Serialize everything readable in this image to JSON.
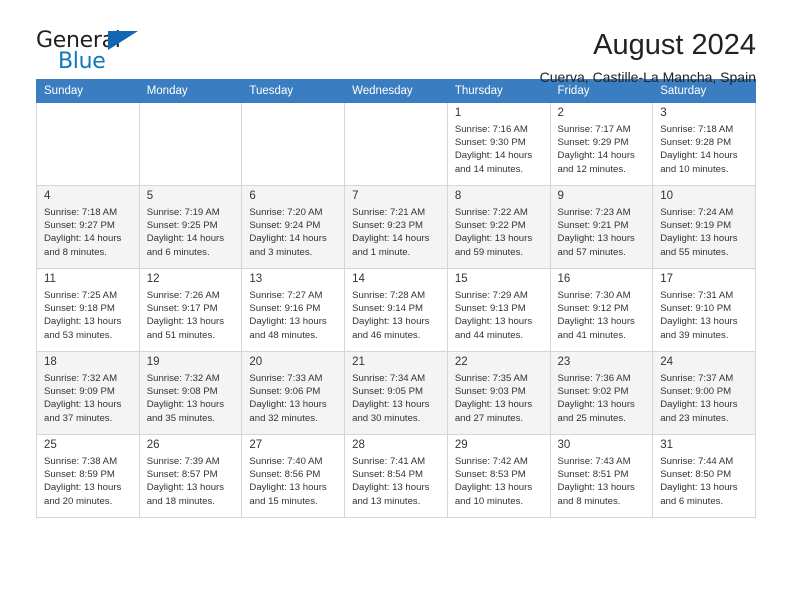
{
  "brand": {
    "name_top": "General",
    "name_bottom": "Blue",
    "triangle_color": "#1167b1",
    "blue_text_color": "#1278be"
  },
  "header": {
    "title": "August 2024",
    "subtitle": "Cuerva, Castille-La Mancha, Spain"
  },
  "theme": {
    "header_bg": "#3a7dc0",
    "header_text": "#ffffff",
    "shaded_row_bg": "#f4f4f4",
    "grid_line": "#d6d6d6"
  },
  "weekday_headers": [
    "Sunday",
    "Monday",
    "Tuesday",
    "Wednesday",
    "Thursday",
    "Friday",
    "Saturday"
  ],
  "labels": {
    "sunrise_prefix": "Sunrise:",
    "sunset_prefix": "Sunset:",
    "daylight_prefix": "Daylight:"
  },
  "weeks": [
    {
      "shaded": false,
      "days": [
        {
          "num": "",
          "l1": "",
          "l2": "",
          "l3": "",
          "l4": ""
        },
        {
          "num": "",
          "l1": "",
          "l2": "",
          "l3": "",
          "l4": ""
        },
        {
          "num": "",
          "l1": "",
          "l2": "",
          "l3": "",
          "l4": ""
        },
        {
          "num": "",
          "l1": "",
          "l2": "",
          "l3": "",
          "l4": ""
        },
        {
          "num": "1",
          "l1": "Sunrise: 7:16 AM",
          "l2": "Sunset: 9:30 PM",
          "l3": "Daylight: 14 hours",
          "l4": "and 14 minutes."
        },
        {
          "num": "2",
          "l1": "Sunrise: 7:17 AM",
          "l2": "Sunset: 9:29 PM",
          "l3": "Daylight: 14 hours",
          "l4": "and 12 minutes."
        },
        {
          "num": "3",
          "l1": "Sunrise: 7:18 AM",
          "l2": "Sunset: 9:28 PM",
          "l3": "Daylight: 14 hours",
          "l4": "and 10 minutes."
        }
      ]
    },
    {
      "shaded": true,
      "days": [
        {
          "num": "4",
          "l1": "Sunrise: 7:18 AM",
          "l2": "Sunset: 9:27 PM",
          "l3": "Daylight: 14 hours",
          "l4": "and 8 minutes."
        },
        {
          "num": "5",
          "l1": "Sunrise: 7:19 AM",
          "l2": "Sunset: 9:25 PM",
          "l3": "Daylight: 14 hours",
          "l4": "and 6 minutes."
        },
        {
          "num": "6",
          "l1": "Sunrise: 7:20 AM",
          "l2": "Sunset: 9:24 PM",
          "l3": "Daylight: 14 hours",
          "l4": "and 3 minutes."
        },
        {
          "num": "7",
          "l1": "Sunrise: 7:21 AM",
          "l2": "Sunset: 9:23 PM",
          "l3": "Daylight: 14 hours",
          "l4": "and 1 minute."
        },
        {
          "num": "8",
          "l1": "Sunrise: 7:22 AM",
          "l2": "Sunset: 9:22 PM",
          "l3": "Daylight: 13 hours",
          "l4": "and 59 minutes."
        },
        {
          "num": "9",
          "l1": "Sunrise: 7:23 AM",
          "l2": "Sunset: 9:21 PM",
          "l3": "Daylight: 13 hours",
          "l4": "and 57 minutes."
        },
        {
          "num": "10",
          "l1": "Sunrise: 7:24 AM",
          "l2": "Sunset: 9:19 PM",
          "l3": "Daylight: 13 hours",
          "l4": "and 55 minutes."
        }
      ]
    },
    {
      "shaded": false,
      "days": [
        {
          "num": "11",
          "l1": "Sunrise: 7:25 AM",
          "l2": "Sunset: 9:18 PM",
          "l3": "Daylight: 13 hours",
          "l4": "and 53 minutes."
        },
        {
          "num": "12",
          "l1": "Sunrise: 7:26 AM",
          "l2": "Sunset: 9:17 PM",
          "l3": "Daylight: 13 hours",
          "l4": "and 51 minutes."
        },
        {
          "num": "13",
          "l1": "Sunrise: 7:27 AM",
          "l2": "Sunset: 9:16 PM",
          "l3": "Daylight: 13 hours",
          "l4": "and 48 minutes."
        },
        {
          "num": "14",
          "l1": "Sunrise: 7:28 AM",
          "l2": "Sunset: 9:14 PM",
          "l3": "Daylight: 13 hours",
          "l4": "and 46 minutes."
        },
        {
          "num": "15",
          "l1": "Sunrise: 7:29 AM",
          "l2": "Sunset: 9:13 PM",
          "l3": "Daylight: 13 hours",
          "l4": "and 44 minutes."
        },
        {
          "num": "16",
          "l1": "Sunrise: 7:30 AM",
          "l2": "Sunset: 9:12 PM",
          "l3": "Daylight: 13 hours",
          "l4": "and 41 minutes."
        },
        {
          "num": "17",
          "l1": "Sunrise: 7:31 AM",
          "l2": "Sunset: 9:10 PM",
          "l3": "Daylight: 13 hours",
          "l4": "and 39 minutes."
        }
      ]
    },
    {
      "shaded": true,
      "days": [
        {
          "num": "18",
          "l1": "Sunrise: 7:32 AM",
          "l2": "Sunset: 9:09 PM",
          "l3": "Daylight: 13 hours",
          "l4": "and 37 minutes."
        },
        {
          "num": "19",
          "l1": "Sunrise: 7:32 AM",
          "l2": "Sunset: 9:08 PM",
          "l3": "Daylight: 13 hours",
          "l4": "and 35 minutes."
        },
        {
          "num": "20",
          "l1": "Sunrise: 7:33 AM",
          "l2": "Sunset: 9:06 PM",
          "l3": "Daylight: 13 hours",
          "l4": "and 32 minutes."
        },
        {
          "num": "21",
          "l1": "Sunrise: 7:34 AM",
          "l2": "Sunset: 9:05 PM",
          "l3": "Daylight: 13 hours",
          "l4": "and 30 minutes."
        },
        {
          "num": "22",
          "l1": "Sunrise: 7:35 AM",
          "l2": "Sunset: 9:03 PM",
          "l3": "Daylight: 13 hours",
          "l4": "and 27 minutes."
        },
        {
          "num": "23",
          "l1": "Sunrise: 7:36 AM",
          "l2": "Sunset: 9:02 PM",
          "l3": "Daylight: 13 hours",
          "l4": "and 25 minutes."
        },
        {
          "num": "24",
          "l1": "Sunrise: 7:37 AM",
          "l2": "Sunset: 9:00 PM",
          "l3": "Daylight: 13 hours",
          "l4": "and 23 minutes."
        }
      ]
    },
    {
      "shaded": false,
      "days": [
        {
          "num": "25",
          "l1": "Sunrise: 7:38 AM",
          "l2": "Sunset: 8:59 PM",
          "l3": "Daylight: 13 hours",
          "l4": "and 20 minutes."
        },
        {
          "num": "26",
          "l1": "Sunrise: 7:39 AM",
          "l2": "Sunset: 8:57 PM",
          "l3": "Daylight: 13 hours",
          "l4": "and 18 minutes."
        },
        {
          "num": "27",
          "l1": "Sunrise: 7:40 AM",
          "l2": "Sunset: 8:56 PM",
          "l3": "Daylight: 13 hours",
          "l4": "and 15 minutes."
        },
        {
          "num": "28",
          "l1": "Sunrise: 7:41 AM",
          "l2": "Sunset: 8:54 PM",
          "l3": "Daylight: 13 hours",
          "l4": "and 13 minutes."
        },
        {
          "num": "29",
          "l1": "Sunrise: 7:42 AM",
          "l2": "Sunset: 8:53 PM",
          "l3": "Daylight: 13 hours",
          "l4": "and 10 minutes."
        },
        {
          "num": "30",
          "l1": "Sunrise: 7:43 AM",
          "l2": "Sunset: 8:51 PM",
          "l3": "Daylight: 13 hours",
          "l4": "and 8 minutes."
        },
        {
          "num": "31",
          "l1": "Sunrise: 7:44 AM",
          "l2": "Sunset: 8:50 PM",
          "l3": "Daylight: 13 hours",
          "l4": "and 6 minutes."
        }
      ]
    }
  ]
}
